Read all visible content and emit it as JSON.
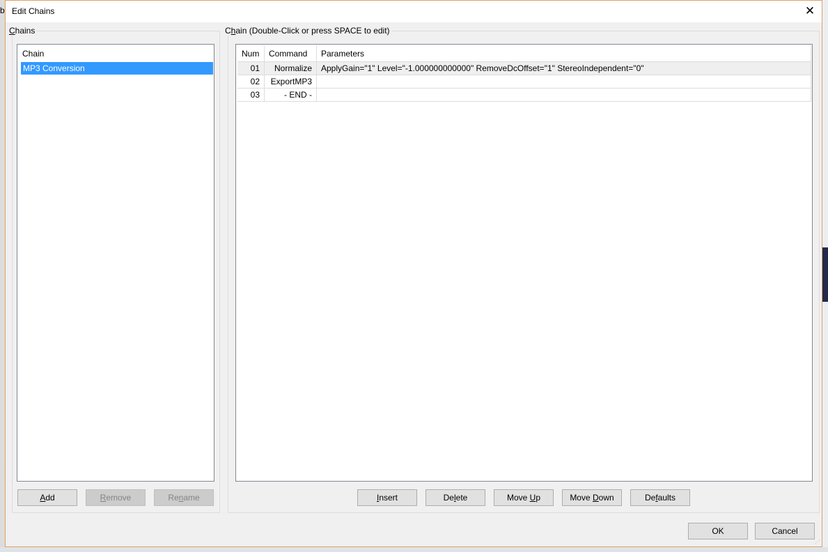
{
  "window": {
    "title": "Edit Chains",
    "close_label": "✕"
  },
  "chains_panel": {
    "group_label_prefix": "",
    "group_label_mnemonic": "C",
    "group_label_rest": "hains",
    "column_header": "Chain",
    "items": [
      {
        "label": "MP3 Conversion",
        "selected": true
      }
    ],
    "buttons": {
      "add": {
        "m": "A",
        "rest": "dd",
        "pre": "",
        "enabled": true
      },
      "remove": {
        "pre": "",
        "m": "R",
        "rest": "emove",
        "enabled": false
      },
      "rename": {
        "pre": "Re",
        "m": "n",
        "rest": "ame",
        "enabled": false
      }
    }
  },
  "chain_panel": {
    "group_label_pre": "C",
    "group_label_mnemonic": "h",
    "group_label_rest": "ain (Double-Click or press SPACE to edit)",
    "columns": [
      "Num",
      "Command",
      "Parameters"
    ],
    "rows": [
      {
        "num": "01",
        "command": "Normalize",
        "parameters": "ApplyGain=\"1\" Level=\"-1.000000000000\" RemoveDcOffset=\"1\" StereoIndependent=\"0\"",
        "selected": true
      },
      {
        "num": "02",
        "command": "ExportMP3",
        "parameters": ""
      },
      {
        "num": "03",
        "command": "- END -",
        "parameters": ""
      }
    ],
    "buttons": {
      "insert": {
        "pre": "",
        "m": "I",
        "rest": "nsert"
      },
      "delete": {
        "pre": "De",
        "m": "l",
        "rest": "ete"
      },
      "move_up": {
        "pre": "Move ",
        "m": "U",
        "rest": "p"
      },
      "move_down": {
        "pre": "Move ",
        "m": "D",
        "rest": "own"
      },
      "defaults": {
        "pre": "De",
        "m": "f",
        "rest": "aults"
      }
    }
  },
  "footer": {
    "ok_label": "OK",
    "cancel_label": "Cancel"
  },
  "background": {
    "left_glimpse": "b"
  }
}
